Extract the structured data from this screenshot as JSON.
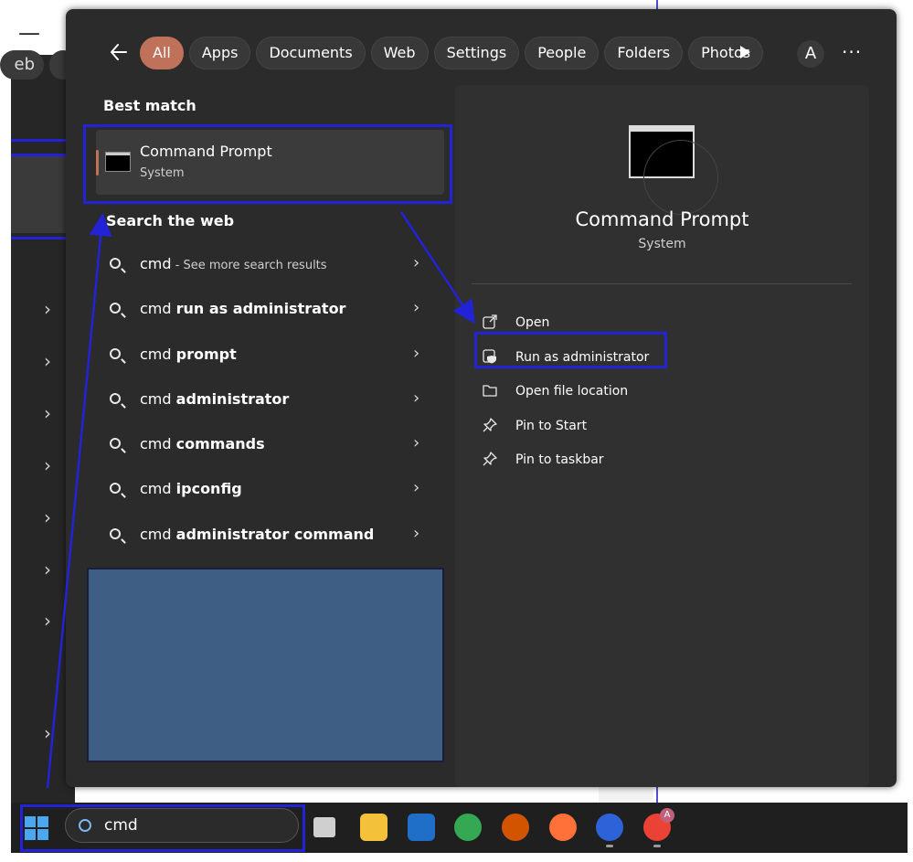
{
  "background": {
    "tab_partial": "eb"
  },
  "search_filter": {
    "tabs": [
      {
        "label": "All",
        "active": true
      },
      {
        "label": "Apps"
      },
      {
        "label": "Documents"
      },
      {
        "label": "Web"
      },
      {
        "label": "Settings"
      },
      {
        "label": "People"
      },
      {
        "label": "Folders"
      },
      {
        "label": "Photos"
      }
    ],
    "account_initial": "A",
    "more_label": "···"
  },
  "best_match": {
    "heading": "Best match",
    "name": "Command Prompt",
    "type": "System"
  },
  "web": {
    "heading": "Search the web",
    "results": [
      {
        "query": "cmd",
        "suffix": " - See more search results",
        "bold": ""
      },
      {
        "query": "cmd",
        "bold": "run as administrator"
      },
      {
        "query": "cmd",
        "bold": "prompt"
      },
      {
        "query": "cmd",
        "bold": "administrator"
      },
      {
        "query": "cmd",
        "bold": "commands"
      },
      {
        "query": "cmd",
        "bold": "ipconfig"
      },
      {
        "query": "cmd",
        "bold": "administrator command"
      }
    ]
  },
  "details": {
    "title": "Command Prompt",
    "subtitle": "System",
    "actions": [
      {
        "label": "Open",
        "icon": "open-external-icon"
      },
      {
        "label": "Run as administrator",
        "icon": "shield-admin-icon"
      },
      {
        "label": "Open file location",
        "icon": "folder-icon"
      },
      {
        "label": "Pin to Start",
        "icon": "pin-icon"
      },
      {
        "label": "Pin to taskbar",
        "icon": "pin-icon"
      }
    ]
  },
  "taskbar": {
    "search_value": "cmd",
    "apps": [
      {
        "name": "task-view",
        "color": "#cfcfcf"
      },
      {
        "name": "file-explorer",
        "color": "#f3c13a"
      },
      {
        "name": "outlook",
        "color": "#1f6fc8"
      },
      {
        "name": "chrome",
        "color": "#34a853"
      },
      {
        "name": "remote-desktop",
        "color": "#d35400"
      },
      {
        "name": "firefox",
        "color": "#ff7139"
      },
      {
        "name": "webex",
        "color": "#2d62d8"
      },
      {
        "name": "chrome-profile",
        "color": "#ea4335"
      }
    ],
    "chrome_profile_badge": "A"
  },
  "colors": {
    "accent": "#c0715a",
    "highlight": "#2323d6"
  }
}
